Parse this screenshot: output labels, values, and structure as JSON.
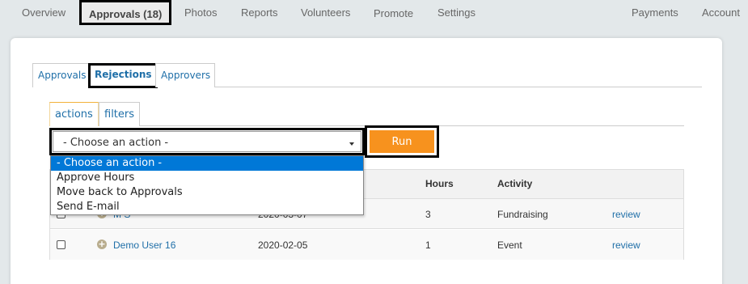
{
  "topnav": {
    "items": [
      "Overview",
      "Approvals (18)",
      "Photos",
      "Reports",
      "Volunteers",
      "Promote",
      "Settings"
    ],
    "right_items": [
      "Payments",
      "Account"
    ]
  },
  "tabs": [
    "Approvals",
    "Rejections",
    "Approvers"
  ],
  "subtabs": [
    "actions",
    "filters"
  ],
  "action_select": {
    "value": "- Choose an action -",
    "options": [
      "- Choose an action -",
      "Approve Hours",
      "Move back to Approvals",
      "Send E-mail"
    ]
  },
  "run_label": "Run",
  "table": {
    "headers": [
      "Hours",
      "Activity"
    ],
    "rows": [
      {
        "name": "M S",
        "date": "2020-03-07",
        "hours": "3",
        "activity": "Fundraising",
        "action": "review"
      },
      {
        "name": "Demo User 16",
        "date": "2020-02-05",
        "hours": "1",
        "activity": "Event",
        "action": "review"
      }
    ]
  }
}
